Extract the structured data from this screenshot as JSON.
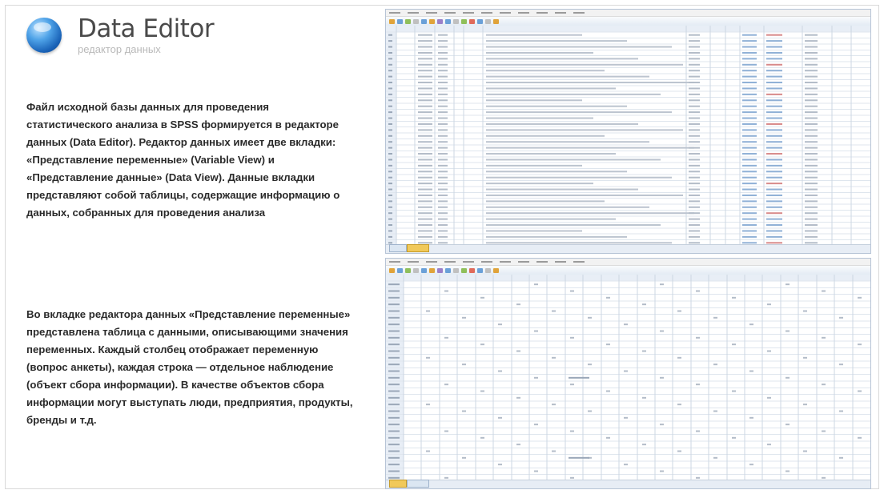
{
  "header": {
    "title": "Data Editor",
    "subtitle": "редактор данных"
  },
  "content": {
    "paragraph1": "Файл исходной базы данных для проведения статистического анализа в SPSS формируется в редакторе данных (Data Editor). Редактор данных имеет две вкладки: «Представление переменные» (Variable View) и «Представление данные» (Data View). Данные вкладки представляют собой таблицы, содержащие информацию о данных, собранных для проведения анализа",
    "paragraph2": "Во вкладке редактора данных «Представление переменные» представлена таблица с данными, описывающими значения переменных. Каждый столбец отображает переменную (вопрос анкеты), каждая строка — отдельное наблюдение (объект сбора информации). В качестве объектов сбора информации могут выступать люди, предприятия, продукты, бренды и т.д."
  },
  "screenshots": {
    "variable_view": {
      "rows": 36,
      "col_fractions": [
        0.022,
        0.06,
        0.1,
        0.14,
        0.16,
        0.2,
        0.62,
        0.67,
        0.7,
        0.73,
        0.78,
        0.86,
        0.92,
        0.96
      ]
    },
    "data_view": {
      "rows": 30,
      "col_count": 26
    }
  },
  "colors": {
    "accent_blue": "#1a63b8",
    "grid_line": "#dfe6ee",
    "row_header": "#e8eef6",
    "active_tab": "#f1c95a"
  }
}
